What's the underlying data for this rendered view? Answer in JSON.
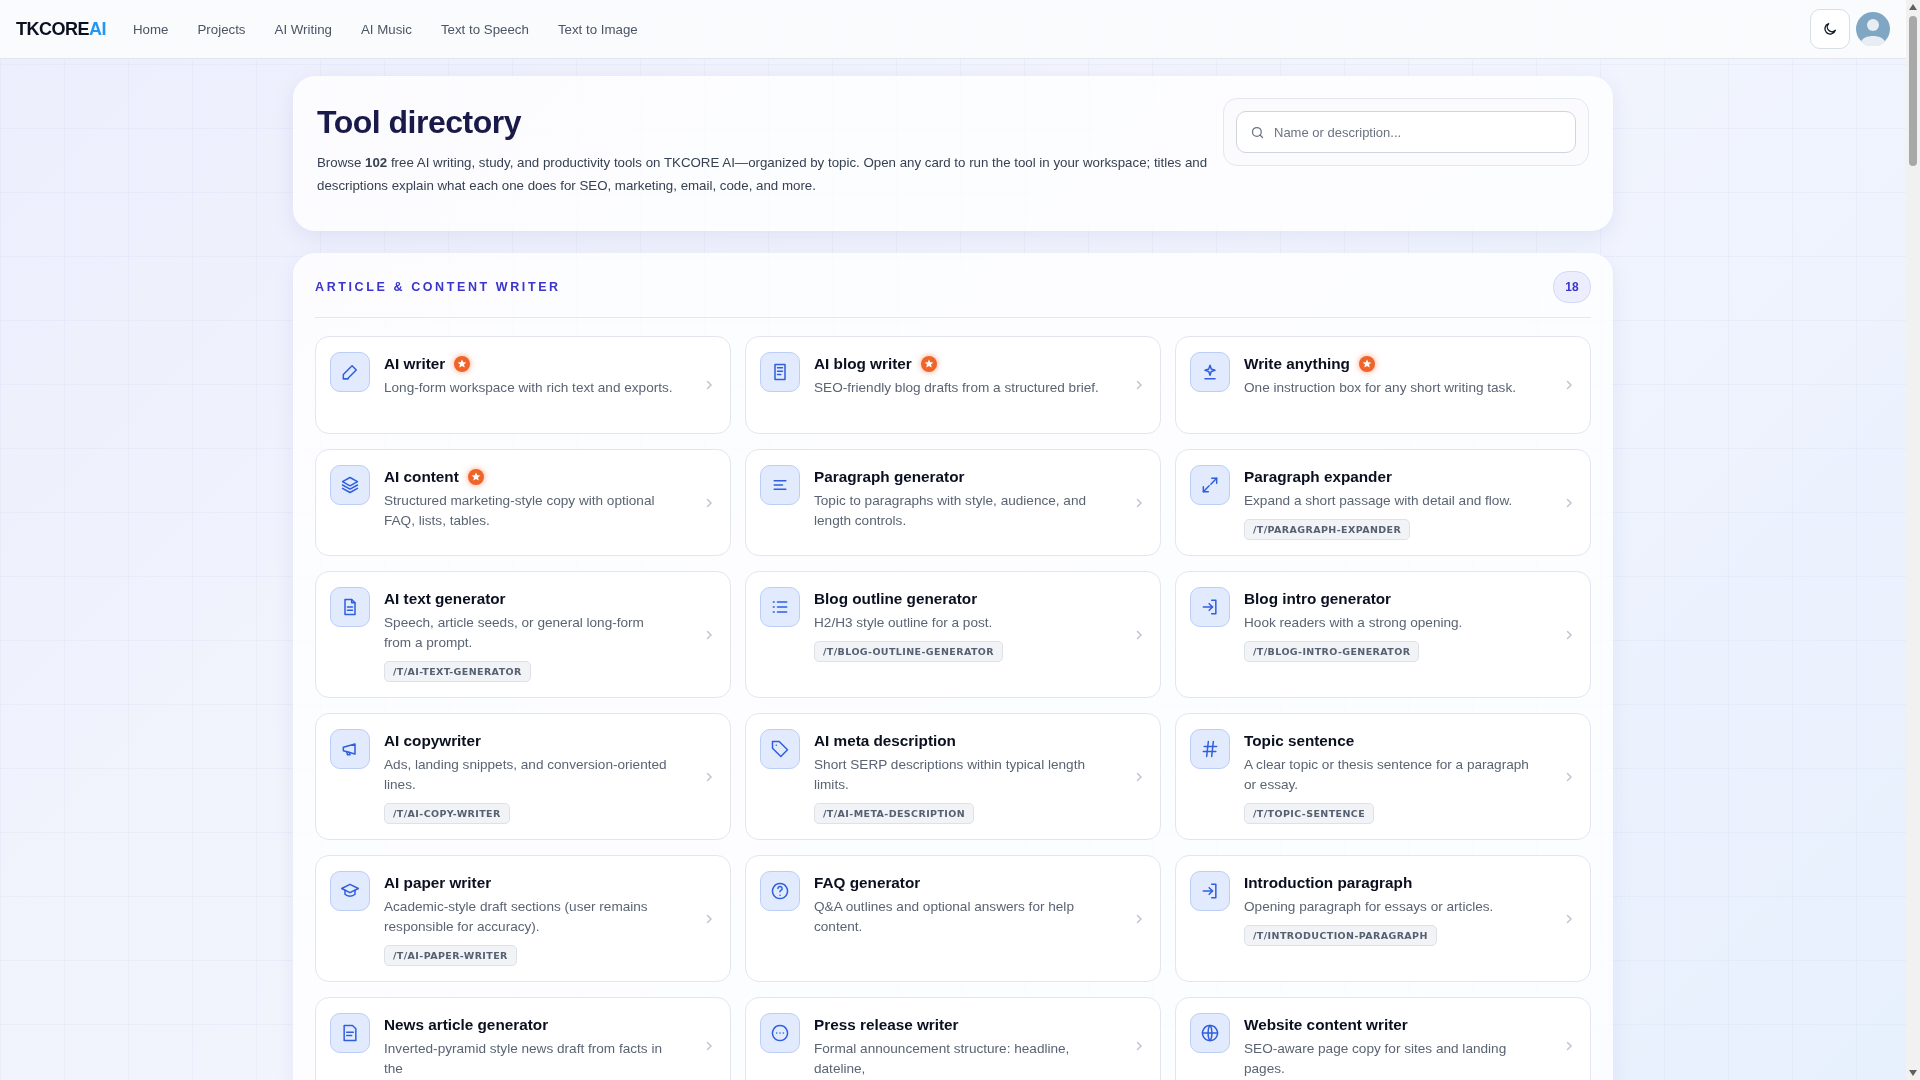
{
  "nav": {
    "logo": {
      "main": "TKCORE",
      "accent": "AI"
    },
    "links": [
      "Home",
      "Projects",
      "AI Writing",
      "AI Music",
      "Text to Speech",
      "Text to Image"
    ]
  },
  "intro": {
    "title": "Tool directory",
    "text": "Browse **102** free AI writing, study, and productivity tools on TKCORE AI—organized by topic. Open any card to run the tool in your workspace; titles and descriptions explain what each one does for SEO, marketing, email, code, and more.",
    "search": {
      "placeholder": "Name or description..."
    }
  },
  "section": {
    "title": "ARTICLE & CONTENT WRITER",
    "count": "18",
    "tools": [
      {
        "title": "AI writer",
        "featured": true,
        "description": "Long-form workspace with rich text and exports."
      },
      {
        "title": "AI blog writer",
        "featured": true,
        "description": "SEO-friendly blog drafts from a structured brief."
      },
      {
        "title": "Write anything",
        "featured": true,
        "description": "One instruction box for any short writing task."
      },
      {
        "title": "AI content",
        "featured": true,
        "description": "Structured marketing-style copy with optional FAQ, lists, tables."
      },
      {
        "title": "Paragraph generator",
        "featured": false,
        "description": "Topic to paragraphs with style, audience, and length controls."
      },
      {
        "title": "Paragraph expander",
        "featured": false,
        "description": "Expand a short passage with detail and flow.",
        "path": "/T/PARAGRAPH-EXPANDER"
      },
      {
        "title": "AI text generator",
        "featured": false,
        "description": "Speech, article seeds, or general long-form from a prompt.",
        "path": "/T/AI-TEXT-GENERATOR"
      },
      {
        "title": "Blog outline generator",
        "featured": false,
        "description": "H2/H3 style outline for a post.",
        "path": "/T/BLOG-OUTLINE-GENERATOR"
      },
      {
        "title": "Blog intro generator",
        "featured": false,
        "description": "Hook readers with a strong opening.",
        "path": "/T/BLOG-INTRO-GENERATOR"
      },
      {
        "title": "AI copywriter",
        "featured": false,
        "description": "Ads, landing snippets, and conversion-oriented lines.",
        "path": "/T/AI-COPY-WRITER"
      },
      {
        "title": "AI meta description",
        "featured": false,
        "description": "Short SERP descriptions within typical length limits.",
        "path": "/T/AI-META-DESCRIPTION"
      },
      {
        "title": "Topic sentence",
        "featured": false,
        "description": "A clear topic or thesis sentence for a paragraph or essay.",
        "path": "/T/TOPIC-SENTENCE"
      },
      {
        "title": "AI paper writer",
        "featured": false,
        "description": "Academic-style draft sections (user remains responsible for accuracy).",
        "path": "/T/AI-PAPER-WRITER"
      },
      {
        "title": "FAQ generator",
        "featured": false,
        "description": "Q&A outlines and optional answers for help content."
      },
      {
        "title": "Introduction paragraph",
        "featured": false,
        "description": "Opening paragraph for essays or articles.",
        "path": "/T/INTRODUCTION-PARAGRAPH"
      },
      {
        "title": "News article generator",
        "featured": false,
        "description": "Inverted-pyramid style news draft from facts in the"
      },
      {
        "title": "Press release writer",
        "featured": false,
        "description": "Formal announcement structure: headline, dateline,"
      },
      {
        "title": "Website content writer",
        "featured": false,
        "description": "SEO-aware page copy for sites and landing pages."
      }
    ]
  }
}
